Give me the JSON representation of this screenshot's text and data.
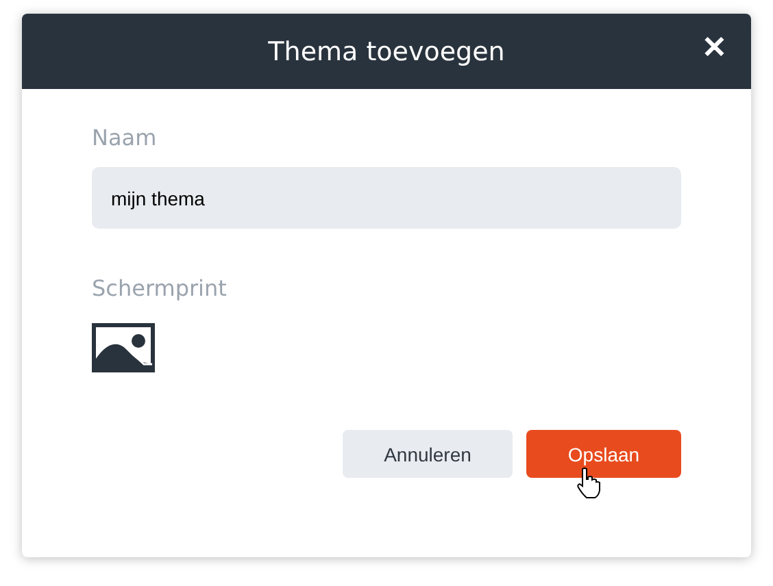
{
  "dialog": {
    "title": "Thema toevoegen",
    "close": "✕"
  },
  "fields": [
    {
      "label": "Naam",
      "value": "mijn thema"
    }
  ],
  "screenshot": {
    "label": "Schermprint"
  },
  "buttons": [
    {
      "label": "Annuleren",
      "kind": "secondary"
    },
    {
      "label": "Opslaan",
      "kind": "primary"
    }
  ]
}
